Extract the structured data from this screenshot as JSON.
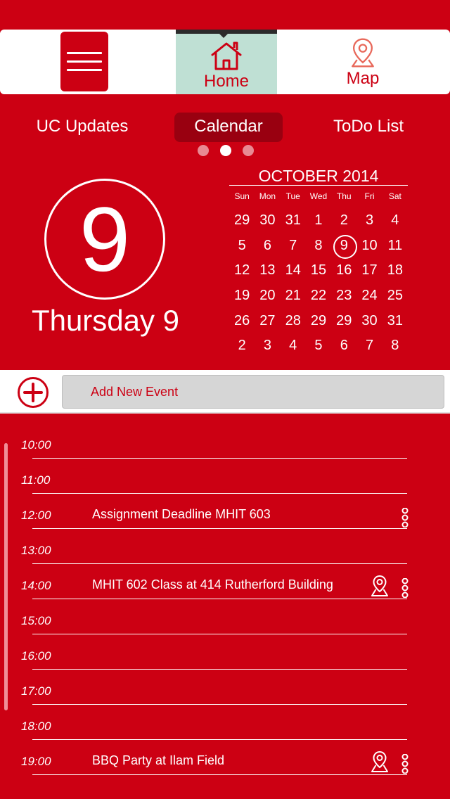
{
  "topnav": {
    "menu_icon": "hamburger-menu-icon",
    "home_label": "Home",
    "map_label": "Map"
  },
  "sections": {
    "updates": "UC Updates",
    "calendar": "Calendar",
    "todo": "ToDo List",
    "page_dots": 3,
    "active_dot": 2
  },
  "today": {
    "number": "9",
    "label": "Thursday 9"
  },
  "calendar": {
    "month_title": "OCTOBER 2014",
    "weekdays": [
      "Sun",
      "Mon",
      "Tue",
      "Wed",
      "Thu",
      "Fri",
      "Sat"
    ],
    "weeks": [
      [
        "29",
        "30",
        "31",
        "1",
        "2",
        "3",
        "4"
      ],
      [
        "5",
        "6",
        "7",
        "8",
        "9",
        "10",
        "11"
      ],
      [
        "12",
        "13",
        "14",
        "15",
        "16",
        "17",
        "18"
      ],
      [
        "19",
        "20",
        "21",
        "22",
        "23",
        "24",
        "25"
      ],
      [
        "26",
        "27",
        "28",
        "29",
        "29",
        "30",
        "31"
      ],
      [
        "2",
        "3",
        "4",
        "5",
        "6",
        "7",
        "8"
      ]
    ],
    "selected": "9"
  },
  "add_event": {
    "placeholder": "Add New Event"
  },
  "timeline": [
    {
      "time": "10:00",
      "event": "",
      "pin": false,
      "more": false
    },
    {
      "time": "11:00",
      "event": "",
      "pin": false,
      "more": false
    },
    {
      "time": "12:00",
      "event": "Assignment Deadline MHIT 603",
      "pin": false,
      "more": true
    },
    {
      "time": "13:00",
      "event": "",
      "pin": false,
      "more": false
    },
    {
      "time": "14:00",
      "event": "MHIT 602 Class at 414  Rutherford Building",
      "pin": true,
      "more": true
    },
    {
      "time": "15:00",
      "event": "",
      "pin": false,
      "more": false
    },
    {
      "time": "16:00",
      "event": "",
      "pin": false,
      "more": false
    },
    {
      "time": "17:00",
      "event": "",
      "pin": false,
      "more": false
    },
    {
      "time": "18:00",
      "event": "",
      "pin": false,
      "more": false
    },
    {
      "time": "19:00",
      "event": "BBQ Party at Ilam Field",
      "pin": true,
      "more": true
    }
  ],
  "colors": {
    "brand_red": "#cc0013",
    "dark_red": "#990010",
    "mint": "#bfe0d4"
  }
}
